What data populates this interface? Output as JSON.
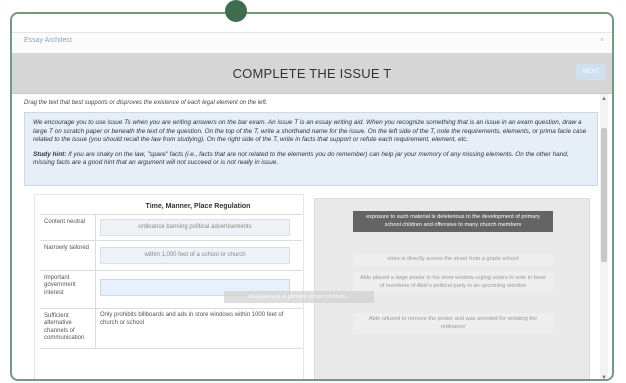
{
  "app": {
    "name": "Essay Architect",
    "close": "×"
  },
  "header": {
    "title": "COMPLETE THE ISSUE T",
    "next_label": "NEXT"
  },
  "instructions": "Drag the text that best supports or disproves the existence of each legal element on the left.",
  "info": {
    "paragraph": "We encourage you to use issue Ts when you are writing answers on the bar exam. An issue T is an essay writing aid. When you recognize something that is an issue in an exam question, draw a large T on scratch paper or beneath the text of the question. On the top of the T, write a shorthand name for the issue. On the left side of the T, note the requirements, elements, or prima facie case related to the issue (you should recall the law from studying). On the right side of the T, write in facts that support or refute each requirement, element, etc.",
    "hint_label": "Study hint:",
    "hint_text": " If you are shaky on the law, \"spare\" facts (i.e., facts that are not related to the elements you do remember) can help jar your memory of any missing elements. On the other hand, missing facts are a good hint that an argument will not succeed or is not really in issue."
  },
  "issue_table": {
    "heading": "Time, Manner, Place Regulation",
    "rows": [
      {
        "label": "Content neutral",
        "value": "ordinance banning political advertisements"
      },
      {
        "label": "Narrowly tailored",
        "value": "within 1,000 feet of a school or church"
      },
      {
        "label": "Important government interest",
        "value": ""
      },
      {
        "label": "Sufficient alternative channels of communication",
        "value": "Only prohibits billboards and ads in store windows within 1000 feet of church or school"
      }
    ]
  },
  "facts": [
    "exposure to such material is deleterious to the development of primary school children and offensive to many church members",
    "store is directly across the street from a grade school",
    "Able placed a large poster in his store window urging voters to vote in favor of members of Able's political party in an upcoming election",
    "Able refused to remove the poster and was arrested for violating the ordinance"
  ],
  "dragging": "development of primary school children...",
  "scroll": {
    "up": "▲",
    "down": "▼"
  }
}
